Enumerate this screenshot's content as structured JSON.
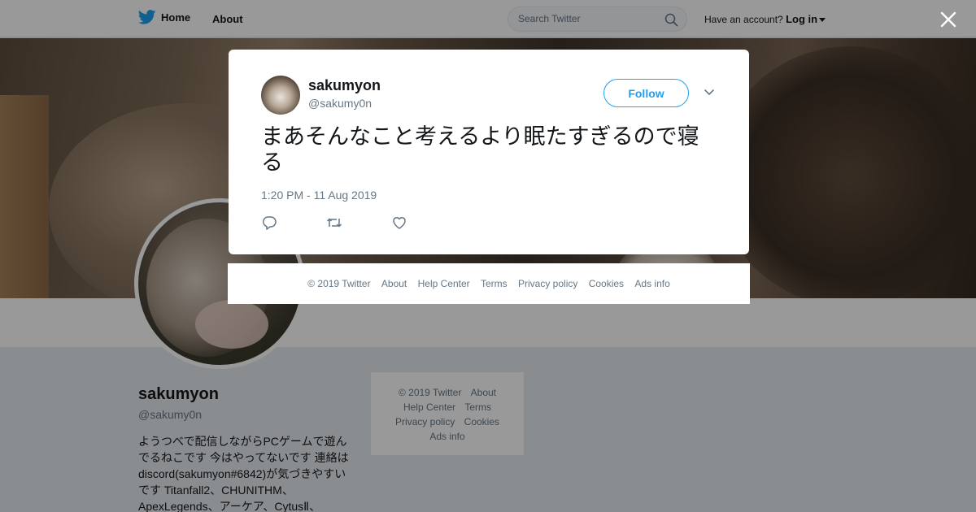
{
  "nav": {
    "home_label": "Home",
    "about_label": "About",
    "search_placeholder": "Search Twitter",
    "account_prompt": "Have an account?",
    "login_label": "Log in"
  },
  "profile": {
    "name": "sakumyon",
    "handle": "@sakumy0n",
    "bio": "ようつべで配信しながらPCゲームで遊んでるねこです 今はやってないです 連絡はdiscord(sakumyon#6842)が気づきやすいです Titanfall2、CHUNITHM、ApexLegends、アーケア、CytusⅡ、"
  },
  "side_footer": {
    "copyright": "© 2019 Twitter",
    "about": "About",
    "help": "Help Center",
    "terms": "Terms",
    "privacy": "Privacy policy",
    "cookies": "Cookies",
    "ads": "Ads info"
  },
  "tweet": {
    "author_name": "sakumyon",
    "author_handle": "@sakumy0n",
    "follow_label": "Follow",
    "text": "まあそんなこと考えるより眠たすぎるので寝る",
    "timestamp": "1:20 PM - 11 Aug 2019"
  },
  "modal_footer": {
    "copyright": "© 2019 Twitter",
    "about": "About",
    "help": "Help Center",
    "terms": "Terms",
    "privacy": "Privacy policy",
    "cookies": "Cookies",
    "ads": "Ads info"
  },
  "colors": {
    "brand": "#1da1f2",
    "text_primary": "#14171a",
    "text_secondary": "#657786",
    "page_bg": "#e6ecf0"
  },
  "icons": [
    "twitter-bird-icon",
    "search-icon",
    "caret-down-icon",
    "close-icon",
    "chevron-down-icon",
    "reply-icon",
    "retweet-icon",
    "like-icon"
  ]
}
